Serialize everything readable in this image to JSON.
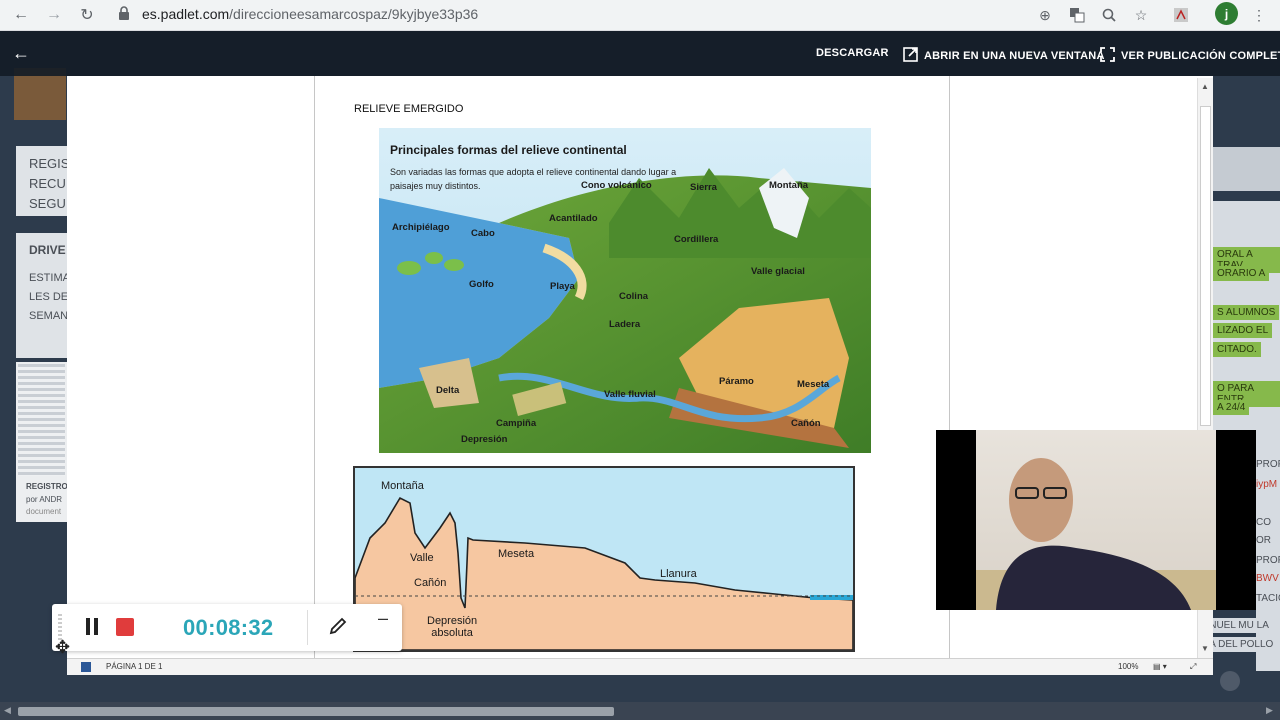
{
  "browser": {
    "url_host": "es.padlet.com",
    "url_path": "/direccioneesamarcospaz/9kyjbye33p36",
    "avatar_letter": "j"
  },
  "overlay": {
    "download_label": "DESCARGAR",
    "open_new_window_label": "ABRIR EN UNA NUEVA VENTANA",
    "full_post_label": "VER PUBLICACIÓN COMPLETA"
  },
  "document": {
    "heading": "RELIEVE EMERGIDO",
    "image1": {
      "title": "Principales formas del relieve continental",
      "subtitle": "Son variadas las formas que adopta el relieve continental dando lugar a paisajes muy distintos.",
      "labels": {
        "cono": "Cono volcánico",
        "sierra": "Sierra",
        "montana": "Montaña",
        "archipielago": "Archipiélago",
        "cabo": "Cabo",
        "acantilado": "Acantilado",
        "cordillera": "Cordillera",
        "valle_glacial": "Valle glacial",
        "golfo": "Golfo",
        "playa": "Playa",
        "colina": "Colina",
        "ladera": "Ladera",
        "paramo": "Páramo",
        "meseta": "Meseta",
        "delta": "Delta",
        "valle_fluvial": "Valle fluvial",
        "campina": "Campiña",
        "canon": "Cañón",
        "depresion": "Depresión"
      }
    },
    "image2": {
      "labels": {
        "montana": "Montaña",
        "valle": "Valle",
        "canon": "Cañón",
        "meseta": "Meseta",
        "llanura": "Llanura",
        "depresion": "Depresión\nabsoluta"
      }
    }
  },
  "status": {
    "page_label": "PÁGINA 1 DE 1",
    "zoom": "100%"
  },
  "recorder": {
    "time": "00:08:32"
  },
  "background_padlet": {
    "card1": "REGIS\nRECU\nSEGU",
    "card2_title": "DRIVE",
    "card2_text": "ESTIMA\nLES DE\nSEMAN",
    "card3_title": "REGISTRO",
    "card3_by": "por ANDR",
    "card3_doc": "document",
    "right_snippets": [
      "ORAL A TRAV",
      "ORARIO A",
      "S ALUMNOS",
      "LIZADO EL",
      "CITADO.",
      "O PARA ENTR",
      "A 24/4"
    ],
    "right_snippets2": [
      "PROF",
      "iypM",
      "CO",
      "OR",
      "PROF",
      "BWV",
      "TACIO",
      "UNUEL MU LA",
      "RA DEL POLLO"
    ]
  }
}
